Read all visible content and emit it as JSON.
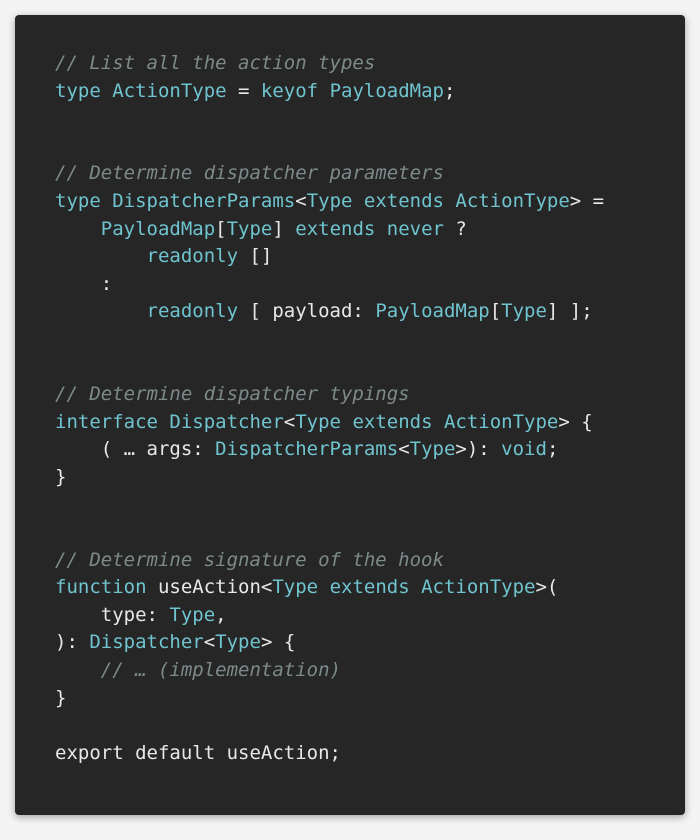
{
  "palette": {
    "background": "#262626",
    "page": "#f4f4f4",
    "keyword": "#6fc4cf",
    "plain": "#e8e8e8",
    "comment": "#7d8a8a"
  },
  "lines": [
    [
      {
        "t": "// List all the action types",
        "k": "comment"
      }
    ],
    [
      {
        "t": "type ",
        "k": "keyword"
      },
      {
        "t": "ActionType",
        "k": "type"
      },
      {
        "t": " = ",
        "k": "plain"
      },
      {
        "t": "keyof ",
        "k": "keyword"
      },
      {
        "t": "PayloadMap",
        "k": "type"
      },
      {
        "t": ";",
        "k": "plain"
      }
    ],
    [],
    [],
    [
      {
        "t": "// Determine dispatcher parameters",
        "k": "comment"
      }
    ],
    [
      {
        "t": "type ",
        "k": "keyword"
      },
      {
        "t": "DispatcherParams",
        "k": "type"
      },
      {
        "t": "<",
        "k": "plain"
      },
      {
        "t": "Type ",
        "k": "type"
      },
      {
        "t": "extends ",
        "k": "keyword"
      },
      {
        "t": "ActionType",
        "k": "type"
      },
      {
        "t": "> =",
        "k": "plain"
      }
    ],
    [
      {
        "t": "    ",
        "k": "plain"
      },
      {
        "t": "PayloadMap",
        "k": "type"
      },
      {
        "t": "[",
        "k": "plain"
      },
      {
        "t": "Type",
        "k": "type"
      },
      {
        "t": "] ",
        "k": "plain"
      },
      {
        "t": "extends ",
        "k": "keyword"
      },
      {
        "t": "never",
        "k": "keyword"
      },
      {
        "t": " ?",
        "k": "plain"
      }
    ],
    [
      {
        "t": "        ",
        "k": "plain"
      },
      {
        "t": "readonly",
        "k": "keyword"
      },
      {
        "t": " []",
        "k": "plain"
      }
    ],
    [
      {
        "t": "    :",
        "k": "plain"
      }
    ],
    [
      {
        "t": "        ",
        "k": "plain"
      },
      {
        "t": "readonly",
        "k": "keyword"
      },
      {
        "t": " [ payload: ",
        "k": "plain"
      },
      {
        "t": "PayloadMap",
        "k": "type"
      },
      {
        "t": "[",
        "k": "plain"
      },
      {
        "t": "Type",
        "k": "type"
      },
      {
        "t": "] ];",
        "k": "plain"
      }
    ],
    [],
    [],
    [
      {
        "t": "// Determine dispatcher typings",
        "k": "comment"
      }
    ],
    [
      {
        "t": "interface ",
        "k": "keyword"
      },
      {
        "t": "Dispatcher",
        "k": "type"
      },
      {
        "t": "<",
        "k": "plain"
      },
      {
        "t": "Type ",
        "k": "type"
      },
      {
        "t": "extends ",
        "k": "keyword"
      },
      {
        "t": "ActionType",
        "k": "type"
      },
      {
        "t": "> {",
        "k": "plain"
      }
    ],
    [
      {
        "t": "    ( … args: ",
        "k": "plain"
      },
      {
        "t": "DispatcherParams",
        "k": "type"
      },
      {
        "t": "<",
        "k": "plain"
      },
      {
        "t": "Type",
        "k": "type"
      },
      {
        "t": ">): ",
        "k": "plain"
      },
      {
        "t": "void",
        "k": "keyword"
      },
      {
        "t": ";",
        "k": "plain"
      }
    ],
    [
      {
        "t": "}",
        "k": "plain"
      }
    ],
    [],
    [],
    [
      {
        "t": "// Determine signature of the hook",
        "k": "comment"
      }
    ],
    [
      {
        "t": "function ",
        "k": "keyword"
      },
      {
        "t": "useAction",
        "k": "plain"
      },
      {
        "t": "<",
        "k": "plain"
      },
      {
        "t": "Type ",
        "k": "type"
      },
      {
        "t": "extends ",
        "k": "keyword"
      },
      {
        "t": "ActionType",
        "k": "type"
      },
      {
        "t": ">(",
        "k": "plain"
      }
    ],
    [
      {
        "t": "    type: ",
        "k": "plain"
      },
      {
        "t": "Type",
        "k": "type"
      },
      {
        "t": ",",
        "k": "plain"
      }
    ],
    [
      {
        "t": "): ",
        "k": "plain"
      },
      {
        "t": "Dispatcher",
        "k": "type"
      },
      {
        "t": "<",
        "k": "plain"
      },
      {
        "t": "Type",
        "k": "type"
      },
      {
        "t": "> {",
        "k": "plain"
      }
    ],
    [
      {
        "t": "    // … (implementation)",
        "k": "comment"
      }
    ],
    [
      {
        "t": "}",
        "k": "plain"
      }
    ],
    [],
    [
      {
        "t": "export default useAction;",
        "k": "plain"
      }
    ]
  ]
}
